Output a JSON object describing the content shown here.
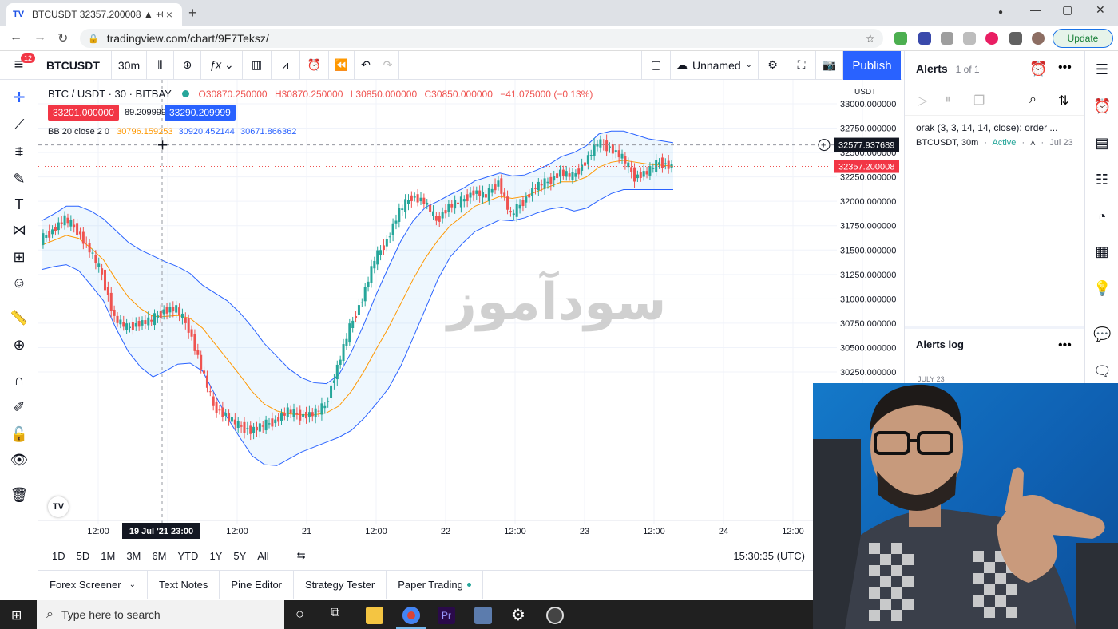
{
  "browser": {
    "tab_title": "BTCUSDT 32357.200008 ▲ +0.6…",
    "tab_close": "×",
    "new_tab": "+",
    "url": "tradingview.com/chart/9F7Teksz/",
    "update_label": "Update",
    "win_min": "—",
    "win_max": "▢",
    "win_close": "✕"
  },
  "app": {
    "menu_badge": "12",
    "symbol": "BTCUSDT",
    "interval": "30m",
    "layout_name": "Unnamed",
    "publish_label": "Publish"
  },
  "legend": {
    "pair": "BTC / USDT · 30 · BITBAY",
    "open": "O30870.250000",
    "high": "H30870.250000",
    "low": "L30850.000000",
    "close": "C30850.000000",
    "change": "−41.075000 (−0.13%)",
    "sell_price": "33201.000000",
    "spread": "89.209999",
    "buy_price": "33290.209999",
    "bb_label": "BB 20 close 2 0",
    "bb_basis": "30796.159253",
    "bb_upper": "30920.452144",
    "bb_lower": "30671.866362"
  },
  "price_axis": {
    "currency": "USDT",
    "ticks": [
      "33000.000000",
      "32750.000000",
      "32500.000000",
      "32250.000000",
      "32000.000000",
      "31750.000000",
      "31500.000000",
      "31250.000000",
      "31000.000000",
      "30750.000000",
      "30500.000000",
      "30250.000000"
    ],
    "crosshair_price": "32577.937689",
    "last_price": "32357.200008"
  },
  "time_axis": {
    "labels": [
      "12:00",
      "21",
      "12:00",
      "22",
      "12:00",
      "23",
      "12:00",
      "24",
      "12:00"
    ],
    "crosshair_time": "19 Jul '21  23:00",
    "first_label": "12:00"
  },
  "timeframes": [
    "1D",
    "5D",
    "1M",
    "3M",
    "6M",
    "YTD",
    "1Y",
    "5Y",
    "All"
  ],
  "clock": "15:30:35 (UTC)",
  "bottom_tabs": [
    "Forex Screener",
    "Text Notes",
    "Pine Editor",
    "Strategy Tester",
    "Paper Trading"
  ],
  "alerts": {
    "title": "Alerts",
    "count": "1 of 1",
    "item_title": "orak (3, 3, 14, 14, close): order ...",
    "item_symbol": "BTCUSDT, 30m",
    "item_status": "Active",
    "item_date": "Jul 23",
    "log_title": "Alerts log",
    "log_date": "JULY 23"
  },
  "watermark": "سودآموز",
  "taskbar": {
    "search_placeholder": "Type here to search"
  },
  "colors": {
    "accent": "#2962ff",
    "sell": "#f23645",
    "buy": "#2962ff",
    "up": "#26a69a",
    "down": "#ef5350",
    "bb_basis": "#ff9800",
    "bb_band": "#2962ff"
  },
  "chart_data": {
    "type": "line",
    "title": "BTC / USDT · 30 · BITBAY",
    "ylim": [
      30050,
      33100
    ],
    "series": [
      {
        "name": "close",
        "values": [
          31600,
          31700,
          31820,
          31700,
          31500,
          31250,
          30800,
          30700,
          30750,
          30780,
          30880,
          30900,
          30700,
          30300,
          29900,
          29800,
          29700,
          29650,
          29700,
          29750,
          29850,
          29800,
          29820,
          29900,
          30300,
          30700,
          31000,
          31400,
          31600,
          31900,
          32050,
          32000,
          31800,
          31950,
          32000,
          32100,
          32050,
          32200,
          31850,
          32000,
          32150,
          32200,
          32300,
          32250,
          32400,
          32600,
          32550,
          32450,
          32250,
          32300,
          32400,
          32357
        ]
      },
      {
        "name": "BB basis",
        "values": [
          31550,
          31600,
          31650,
          31620,
          31520,
          31400,
          31200,
          31020,
          30900,
          30820,
          30820,
          30830,
          30800,
          30700,
          30540,
          30380,
          30220,
          30050,
          29920,
          29850,
          29820,
          29810,
          29810,
          29830,
          29900,
          30050,
          30250,
          30480,
          30700,
          30950,
          31200,
          31420,
          31600,
          31750,
          31850,
          31950,
          32000,
          32050,
          32030,
          32050,
          32100,
          32150,
          32200,
          32200,
          32250,
          32350,
          32400,
          32420,
          32400,
          32380,
          32370,
          32360
        ]
      }
    ]
  }
}
